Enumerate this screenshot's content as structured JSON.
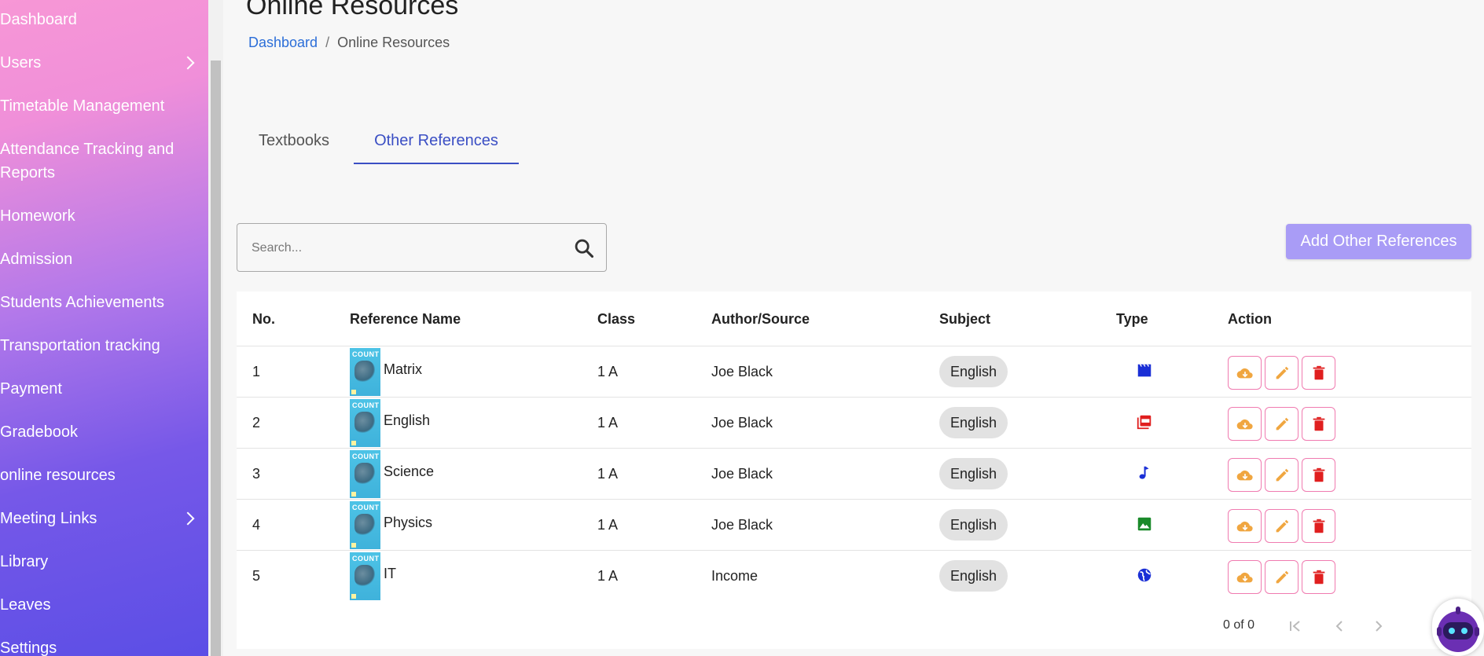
{
  "sidebar": {
    "items": [
      {
        "label": "Dashboard",
        "has_children": false
      },
      {
        "label": "Users",
        "has_children": true
      },
      {
        "label": "Timetable Management",
        "has_children": false
      },
      {
        "label": "Attendance Tracking and Reports",
        "has_children": false
      },
      {
        "label": "Homework",
        "has_children": false
      },
      {
        "label": "Admission",
        "has_children": false
      },
      {
        "label": "Students Achievements",
        "has_children": false
      },
      {
        "label": "Transportation tracking",
        "has_children": false
      },
      {
        "label": "Payment",
        "has_children": false
      },
      {
        "label": "Gradebook",
        "has_children": false
      },
      {
        "label": "online resources",
        "has_children": false
      },
      {
        "label": "Meeting Links",
        "has_children": true
      },
      {
        "label": "Library",
        "has_children": false
      },
      {
        "label": "Leaves",
        "has_children": false
      },
      {
        "label": "Settings",
        "has_children": false
      }
    ]
  },
  "page": {
    "title": "Online Resources",
    "breadcrumb": {
      "home": "Dashboard",
      "separator": "/",
      "current": "Online Resources"
    }
  },
  "tabs": [
    {
      "label": "Textbooks",
      "active": false
    },
    {
      "label": "Other References",
      "active": true
    }
  ],
  "search": {
    "placeholder": "Search...",
    "value": ""
  },
  "add_button": {
    "label": "Add Other References"
  },
  "table": {
    "headers": [
      "No.",
      "Reference Name",
      "Class",
      "Author/Source",
      "Subject",
      "Type",
      "Action"
    ],
    "thumbnail_title": "COUNT",
    "rows": [
      {
        "no": "1",
        "name": "Matrix",
        "class": "1 A",
        "author": "Joe Black",
        "subject": "English",
        "type": "video-icon"
      },
      {
        "no": "2",
        "name": "English",
        "class": "1 A",
        "author": "Joe Black",
        "subject": "English",
        "type": "pdf-icon"
      },
      {
        "no": "3",
        "name": "Science",
        "class": "1 A",
        "author": "Joe Black",
        "subject": "English",
        "type": "audio-icon"
      },
      {
        "no": "4",
        "name": "Physics",
        "class": "1 A",
        "author": "Joe Black",
        "subject": "English",
        "type": "image-icon"
      },
      {
        "no": "5",
        "name": "IT",
        "class": "1 A",
        "author": "Income",
        "subject": "English",
        "type": "web-link-icon"
      }
    ]
  },
  "pagination": {
    "text": "0 of 0"
  },
  "colors": {
    "accent": "#3b4fc4",
    "link": "#2c6ed8",
    "add_button": "#a99cf6",
    "action_border": "#f07bb0",
    "download_icon": "#f0a640",
    "edit_icon": "#f0a640",
    "delete_icon": "#e01f1f"
  }
}
